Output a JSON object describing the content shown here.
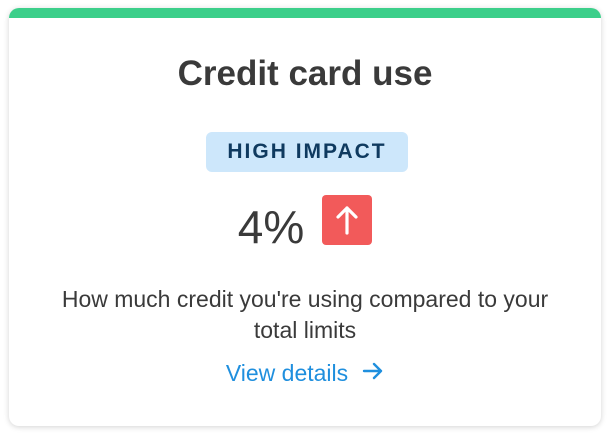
{
  "colors": {
    "accent_bar": "#3ccf8a",
    "badge_bg": "#cde7fb",
    "badge_text": "#0f3a5f",
    "trend_bg": "#f25a5a",
    "link": "#1f8fde"
  },
  "card": {
    "title": "Credit card use",
    "badge": "HIGH IMPACT",
    "value": "4%",
    "trend_icon": "arrow-up-icon",
    "description": "How much credit you're using compared to your total limits",
    "link_label": "View details",
    "link_icon": "arrow-right-icon"
  }
}
